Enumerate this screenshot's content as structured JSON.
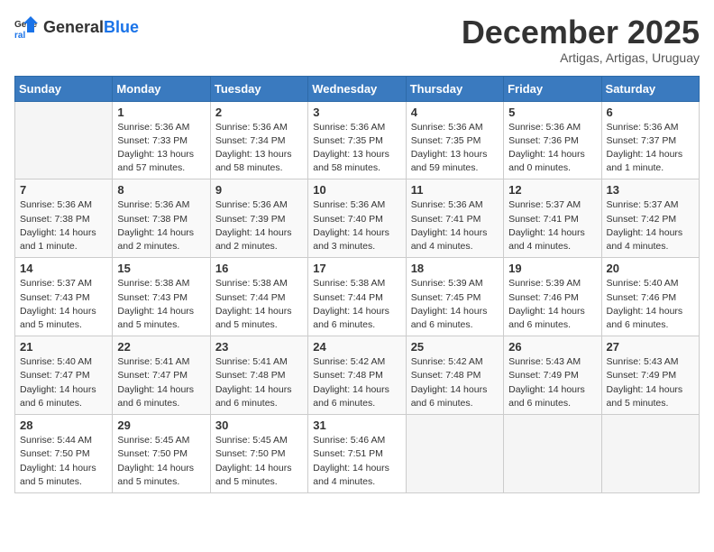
{
  "logo": {
    "text_general": "General",
    "text_blue": "Blue"
  },
  "header": {
    "month": "December 2025",
    "location": "Artigas, Artigas, Uruguay"
  },
  "weekdays": [
    "Sunday",
    "Monday",
    "Tuesday",
    "Wednesday",
    "Thursday",
    "Friday",
    "Saturday"
  ],
  "weeks": [
    [
      {
        "day": "",
        "info": ""
      },
      {
        "day": "1",
        "info": "Sunrise: 5:36 AM\nSunset: 7:33 PM\nDaylight: 13 hours\nand 57 minutes."
      },
      {
        "day": "2",
        "info": "Sunrise: 5:36 AM\nSunset: 7:34 PM\nDaylight: 13 hours\nand 58 minutes."
      },
      {
        "day": "3",
        "info": "Sunrise: 5:36 AM\nSunset: 7:35 PM\nDaylight: 13 hours\nand 58 minutes."
      },
      {
        "day": "4",
        "info": "Sunrise: 5:36 AM\nSunset: 7:35 PM\nDaylight: 13 hours\nand 59 minutes."
      },
      {
        "day": "5",
        "info": "Sunrise: 5:36 AM\nSunset: 7:36 PM\nDaylight: 14 hours\nand 0 minutes."
      },
      {
        "day": "6",
        "info": "Sunrise: 5:36 AM\nSunset: 7:37 PM\nDaylight: 14 hours\nand 1 minute."
      }
    ],
    [
      {
        "day": "7",
        "info": "Sunrise: 5:36 AM\nSunset: 7:38 PM\nDaylight: 14 hours\nand 1 minute."
      },
      {
        "day": "8",
        "info": "Sunrise: 5:36 AM\nSunset: 7:38 PM\nDaylight: 14 hours\nand 2 minutes."
      },
      {
        "day": "9",
        "info": "Sunrise: 5:36 AM\nSunset: 7:39 PM\nDaylight: 14 hours\nand 2 minutes."
      },
      {
        "day": "10",
        "info": "Sunrise: 5:36 AM\nSunset: 7:40 PM\nDaylight: 14 hours\nand 3 minutes."
      },
      {
        "day": "11",
        "info": "Sunrise: 5:36 AM\nSunset: 7:41 PM\nDaylight: 14 hours\nand 4 minutes."
      },
      {
        "day": "12",
        "info": "Sunrise: 5:37 AM\nSunset: 7:41 PM\nDaylight: 14 hours\nand 4 minutes."
      },
      {
        "day": "13",
        "info": "Sunrise: 5:37 AM\nSunset: 7:42 PM\nDaylight: 14 hours\nand 4 minutes."
      }
    ],
    [
      {
        "day": "14",
        "info": "Sunrise: 5:37 AM\nSunset: 7:43 PM\nDaylight: 14 hours\nand 5 minutes."
      },
      {
        "day": "15",
        "info": "Sunrise: 5:38 AM\nSunset: 7:43 PM\nDaylight: 14 hours\nand 5 minutes."
      },
      {
        "day": "16",
        "info": "Sunrise: 5:38 AM\nSunset: 7:44 PM\nDaylight: 14 hours\nand 5 minutes."
      },
      {
        "day": "17",
        "info": "Sunrise: 5:38 AM\nSunset: 7:44 PM\nDaylight: 14 hours\nand 6 minutes."
      },
      {
        "day": "18",
        "info": "Sunrise: 5:39 AM\nSunset: 7:45 PM\nDaylight: 14 hours\nand 6 minutes."
      },
      {
        "day": "19",
        "info": "Sunrise: 5:39 AM\nSunset: 7:46 PM\nDaylight: 14 hours\nand 6 minutes."
      },
      {
        "day": "20",
        "info": "Sunrise: 5:40 AM\nSunset: 7:46 PM\nDaylight: 14 hours\nand 6 minutes."
      }
    ],
    [
      {
        "day": "21",
        "info": "Sunrise: 5:40 AM\nSunset: 7:47 PM\nDaylight: 14 hours\nand 6 minutes."
      },
      {
        "day": "22",
        "info": "Sunrise: 5:41 AM\nSunset: 7:47 PM\nDaylight: 14 hours\nand 6 minutes."
      },
      {
        "day": "23",
        "info": "Sunrise: 5:41 AM\nSunset: 7:48 PM\nDaylight: 14 hours\nand 6 minutes."
      },
      {
        "day": "24",
        "info": "Sunrise: 5:42 AM\nSunset: 7:48 PM\nDaylight: 14 hours\nand 6 minutes."
      },
      {
        "day": "25",
        "info": "Sunrise: 5:42 AM\nSunset: 7:48 PM\nDaylight: 14 hours\nand 6 minutes."
      },
      {
        "day": "26",
        "info": "Sunrise: 5:43 AM\nSunset: 7:49 PM\nDaylight: 14 hours\nand 6 minutes."
      },
      {
        "day": "27",
        "info": "Sunrise: 5:43 AM\nSunset: 7:49 PM\nDaylight: 14 hours\nand 5 minutes."
      }
    ],
    [
      {
        "day": "28",
        "info": "Sunrise: 5:44 AM\nSunset: 7:50 PM\nDaylight: 14 hours\nand 5 minutes."
      },
      {
        "day": "29",
        "info": "Sunrise: 5:45 AM\nSunset: 7:50 PM\nDaylight: 14 hours\nand 5 minutes."
      },
      {
        "day": "30",
        "info": "Sunrise: 5:45 AM\nSunset: 7:50 PM\nDaylight: 14 hours\nand 5 minutes."
      },
      {
        "day": "31",
        "info": "Sunrise: 5:46 AM\nSunset: 7:51 PM\nDaylight: 14 hours\nand 4 minutes."
      },
      {
        "day": "",
        "info": ""
      },
      {
        "day": "",
        "info": ""
      },
      {
        "day": "",
        "info": ""
      }
    ]
  ]
}
